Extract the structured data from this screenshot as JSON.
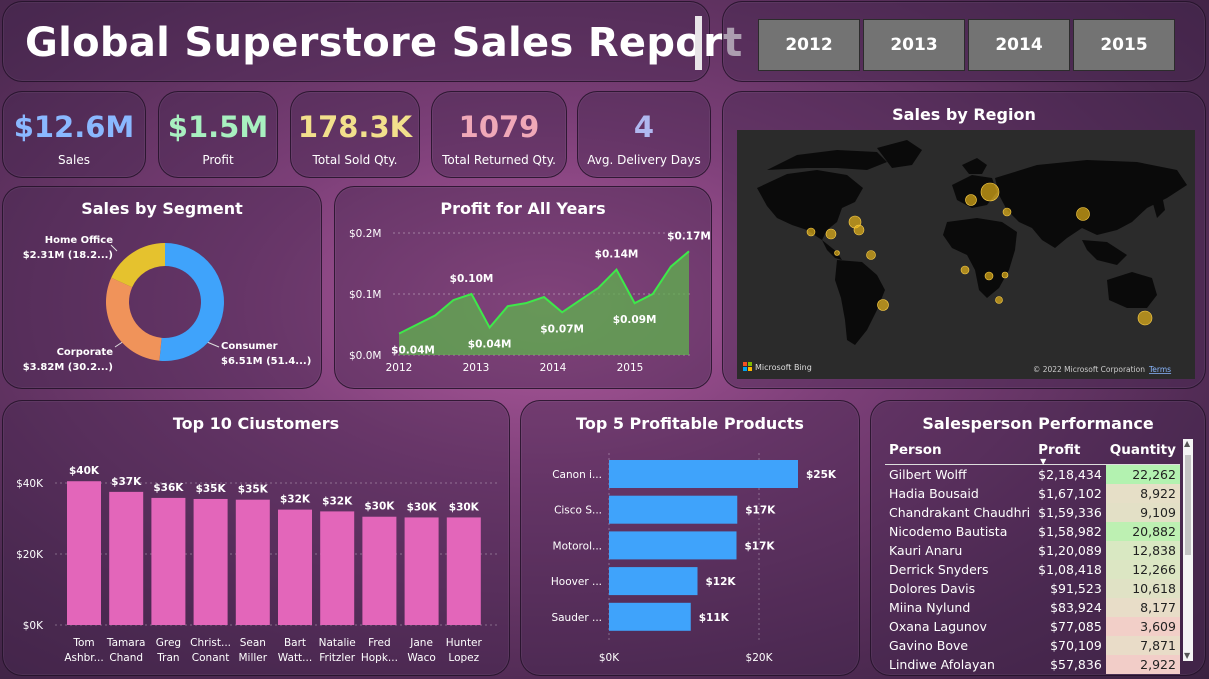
{
  "header": {
    "title": "Global Superstore Sales Report",
    "years": [
      "2012",
      "2013",
      "2014",
      "2015"
    ]
  },
  "kpis": [
    {
      "value": "$12.6M",
      "label": "Sales",
      "color": "#8ab8ff"
    },
    {
      "value": "$1.5M",
      "label": "Profit",
      "color": "#a8f0c0"
    },
    {
      "value": "178.3K",
      "label": "Total Sold Qty.",
      "color": "#f2e08c"
    },
    {
      "value": "1079",
      "label": "Total Returned Qty.",
      "color": "#f0a8b8"
    },
    {
      "value": "4",
      "label": "Avg. Delivery Days",
      "color": "#b0b8f0"
    }
  ],
  "segment": {
    "title": "Sales by Segment",
    "labels": [
      {
        "name": "Home Office",
        "value": "$2.31M (18.2...)"
      },
      {
        "name": "Corporate",
        "value": "$3.82M (30.2...)"
      },
      {
        "name": "Consumer",
        "value": "$6.51M (51.4...)"
      }
    ]
  },
  "profit_chart": {
    "title": "Profit for All Years"
  },
  "region": {
    "title": "Sales by Region",
    "bing": "Microsoft Bing",
    "copyright": "© 2022 Microsoft Corporation",
    "terms": "Terms"
  },
  "customers_chart": {
    "title": "Top 10 Ciustomers"
  },
  "products_chart": {
    "title": "Top 5 Profitable Products"
  },
  "salesperson": {
    "title": "Salesperson Performance",
    "columns": [
      "Person",
      "Profit",
      "Quantity"
    ],
    "rows": [
      {
        "person": "Gilbert Wolff",
        "profit": "$2,18,434",
        "qty": "22,262",
        "color": "#b3f2b0"
      },
      {
        "person": "Hadia Bousaid",
        "profit": "$1,67,102",
        "qty": "8,922",
        "color": "#e6dfc7"
      },
      {
        "person": "Chandrakant Chaudhri",
        "profit": "$1,59,336",
        "qty": "9,109",
        "color": "#e3e0c6"
      },
      {
        "person": "Nicodemo Bautista",
        "profit": "$1,58,982",
        "qty": "20,882",
        "color": "#bdf0b2"
      },
      {
        "person": "Kauri Anaru",
        "profit": "$1,20,089",
        "qty": "12,838",
        "color": "#d9e8c2"
      },
      {
        "person": "Derrick Snyders",
        "profit": "$1,08,418",
        "qty": "12,266",
        "color": "#dce6c3"
      },
      {
        "person": "Dolores Davis",
        "profit": "$91,523",
        "qty": "10,618",
        "color": "#e0e2c5"
      },
      {
        "person": "Miina Nylund",
        "profit": "$83,924",
        "qty": "8,177",
        "color": "#e8ddc8"
      },
      {
        "person": "Oxana Lagunov",
        "profit": "$77,085",
        "qty": "3,609",
        "color": "#f2cfc8"
      },
      {
        "person": "Gavino Bove",
        "profit": "$70,109",
        "qty": "7,871",
        "color": "#e9dcc8"
      },
      {
        "person": "Lindiwe Afolayan",
        "profit": "$57,836",
        "qty": "2,922",
        "color": "#f2cdc8"
      }
    ]
  },
  "chart_data": [
    {
      "type": "pie",
      "title": "Sales by Segment",
      "categories": [
        "Consumer",
        "Corporate",
        "Home Office"
      ],
      "values": [
        6.51,
        3.82,
        2.31
      ],
      "value_labels": [
        "$6.51M (51.4...)",
        "$3.82M (30.2...)",
        "$2.31M (18.2...)"
      ],
      "colors": [
        "#3fa3fb",
        "#f0935a",
        "#e5c22e"
      ]
    },
    {
      "type": "area",
      "title": "Profit for All Years",
      "x_ticks": [
        "2012",
        "2013",
        "2014",
        "2015"
      ],
      "y_ticks": [
        "$0.0M",
        "$0.1M",
        "$0.2M"
      ],
      "ylim": [
        0,
        0.2
      ],
      "values": [
        0.035,
        0.05,
        0.065,
        0.09,
        0.1,
        0.045,
        0.08,
        0.085,
        0.095,
        0.07,
        0.09,
        0.11,
        0.14,
        0.085,
        0.1,
        0.145,
        0.17
      ],
      "data_labels": [
        {
          "index": 0,
          "text": "$0.04M"
        },
        {
          "index": 4,
          "text": "$0.10M"
        },
        {
          "index": 5,
          "text": "$0.04M"
        },
        {
          "index": 9,
          "text": "$0.07M"
        },
        {
          "index": 12,
          "text": "$0.14M"
        },
        {
          "index": 13,
          "text": "$0.09M"
        },
        {
          "index": 16,
          "text": "$0.17M"
        }
      ],
      "color": "#5fb34e"
    },
    {
      "type": "bar",
      "title": "Top 10 Ciustomers",
      "categories": [
        [
          "Tom",
          "Ashbr..."
        ],
        [
          "Tamara",
          "Chand"
        ],
        [
          "Greg",
          "Tran"
        ],
        [
          "Christ...",
          "Conant"
        ],
        [
          "Sean",
          "Miller"
        ],
        [
          "Bart",
          "Watt..."
        ],
        [
          "Natalie",
          "Fritzler"
        ],
        [
          "Fred",
          "Hopk..."
        ],
        [
          "Jane",
          "Waco"
        ],
        [
          "Hunter",
          "Lopez"
        ]
      ],
      "values": [
        40.5,
        37.5,
        35.8,
        35.5,
        35.3,
        32.5,
        32.0,
        30.5,
        30.3,
        30.3
      ],
      "data_labels": [
        "$40K",
        "$37K",
        "$36K",
        "$35K",
        "$35K",
        "$32K",
        "$32K",
        "$30K",
        "$30K",
        "$30K"
      ],
      "y_ticks": [
        "$0K",
        "$20K",
        "$40K"
      ],
      "ylim": [
        0,
        40
      ],
      "color": "#e366ba"
    },
    {
      "type": "bar",
      "orientation": "horizontal",
      "title": "Top 5 Profitable Products",
      "categories": [
        "Canon i...",
        "Cisco S...",
        "Motorol...",
        "Hoover ...",
        "Sauder ..."
      ],
      "values": [
        25.2,
        17.1,
        17.0,
        11.8,
        10.9
      ],
      "data_labels": [
        "$25K",
        "$17K",
        "$17K",
        "$12K",
        "$11K"
      ],
      "x_ticks": [
        "$0K",
        "$20K"
      ],
      "xlim": [
        0,
        20
      ],
      "color": "#3fa3fb"
    }
  ]
}
